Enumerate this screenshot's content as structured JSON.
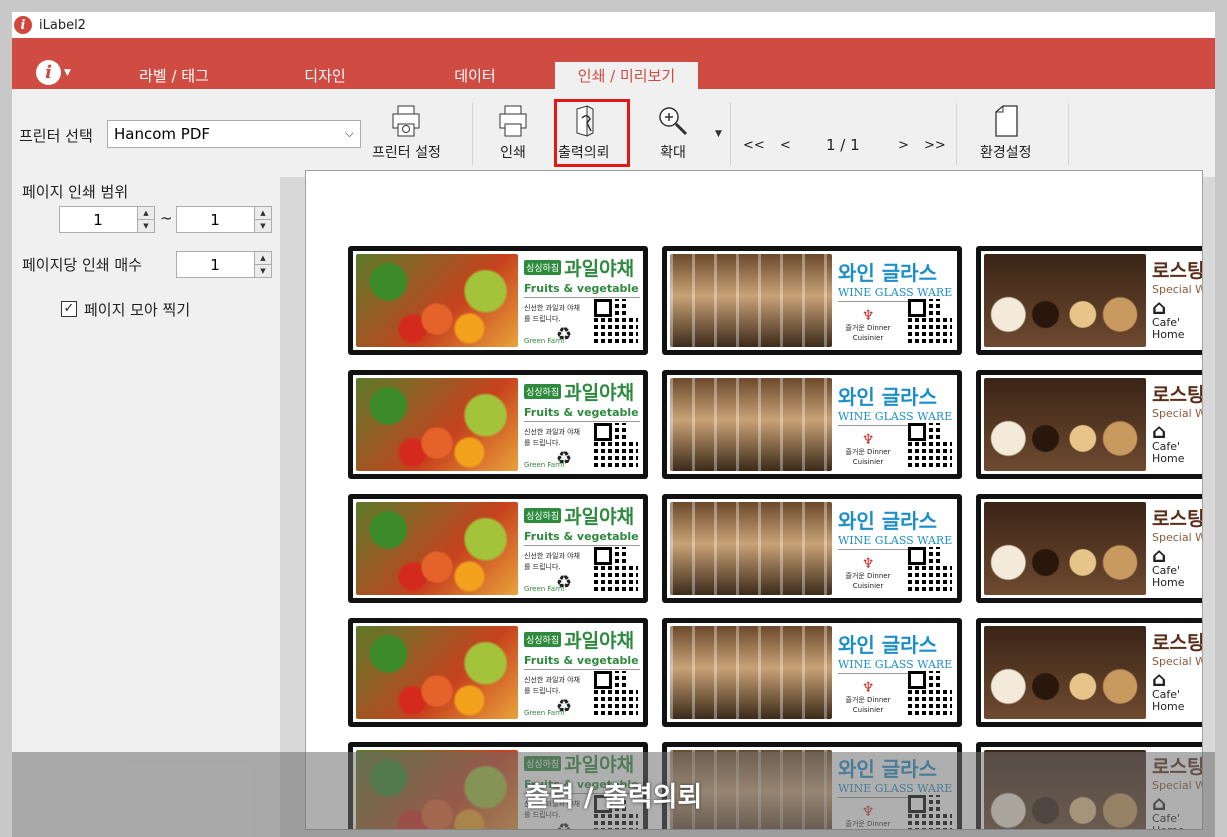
{
  "window": {
    "title": "iLabel2"
  },
  "menu": {
    "app_icon": "info-icon",
    "tabs": [
      {
        "label": "라벨 / 태그"
      },
      {
        "label": "디자인"
      },
      {
        "label": "데이터"
      },
      {
        "label": "인쇄 / 미리보기",
        "active": true
      }
    ]
  },
  "toolbar": {
    "printer_label": "프린터 선택",
    "printer_value": "Hancom PDF",
    "printer_setup": "프린터 설정",
    "print": "인쇄",
    "print_request": "출력의뢰",
    "zoom": "확대",
    "nav_first": "<<",
    "nav_prev": "<",
    "page_indicator": "1 / 1",
    "nav_next": ">",
    "nav_last": ">>",
    "settings": "환경설정"
  },
  "left_panel": {
    "page_range_label": "페이지 인쇄 범위",
    "range_from": "1",
    "range_sep": "~",
    "range_to": "1",
    "copies_label": "페이지당 인쇄 매수",
    "copies_value": "1",
    "collate_label": "페이지 모아 찍기",
    "collate_checked": true
  },
  "labels": {
    "fruit": {
      "badge": "싱싱하침",
      "title": "과일야채",
      "subtitle": "Fruits & vegetable",
      "desc": "신선한 과일과 야채를 드립니다.",
      "brand": "Green Farm"
    },
    "wine": {
      "title": "와인 글라스",
      "subtitle": "WINE GLASS WARE",
      "line1": "즐거운 Dinner",
      "line2": "Cuisinier"
    },
    "cafe": {
      "title": "로스팅",
      "subtitle": "Special W",
      "line1": "Cafe'",
      "line2": "Home"
    },
    "rows": 5
  },
  "caption": "출력 / 출력의뢰",
  "colors": {
    "accent": "#d04b42",
    "highlight": "#e01818"
  }
}
